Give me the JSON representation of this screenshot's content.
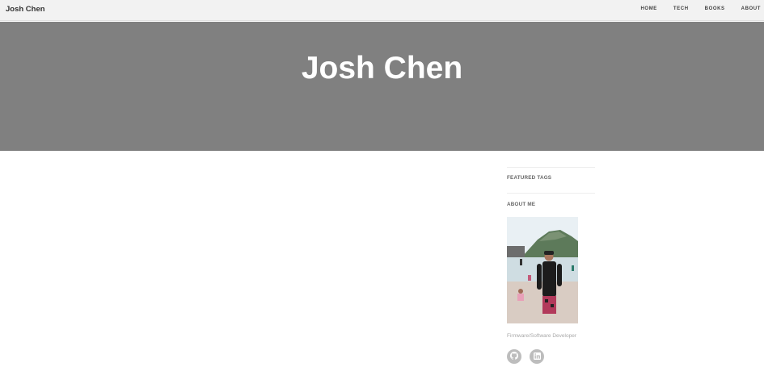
{
  "navbar": {
    "brand": "Josh Chen",
    "links": [
      {
        "label": "HOME"
      },
      {
        "label": "TECH"
      },
      {
        "label": "BOOKS"
      },
      {
        "label": "ABOUT"
      }
    ]
  },
  "header": {
    "title": "Josh Chen"
  },
  "sidebar": {
    "featured_tags_title": "FEATURED TAGS",
    "about_title": "ABOUT ME",
    "description": "Firmware/Software Developer",
    "social": [
      {
        "icon": "github-icon"
      },
      {
        "icon": "linkedin-icon"
      }
    ]
  },
  "colors": {
    "header_bg": "#808080",
    "navbar_bg": "#f2f2f2",
    "social_bg": "#bdbdbd"
  }
}
